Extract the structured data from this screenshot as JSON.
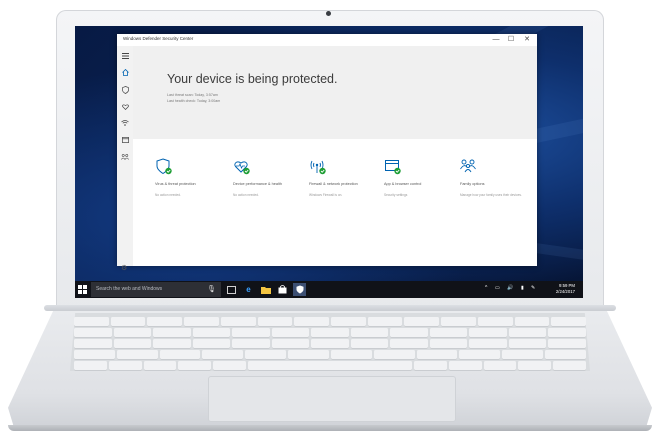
{
  "app": {
    "window_title": "Windows Defender Security Center",
    "controls": {
      "minimize": "—",
      "maximize": "☐",
      "close": "✕"
    },
    "nav_icons": [
      "menu-icon",
      "home-icon",
      "shield-icon",
      "heart-icon",
      "wifi-icon",
      "browser-icon",
      "family-icon",
      "settings-icon"
    ],
    "hero": {
      "title": "Your device is being protected.",
      "line1": "Last threat scan: Today, 3:57am",
      "line2": "Last health check: Today, 3:00am"
    },
    "tiles": [
      {
        "title": "Virus & threat protection",
        "sub": "No action needed.",
        "icon": "virus-shield-icon"
      },
      {
        "title": "Device performance & health",
        "sub": "No action needed.",
        "icon": "health-heart-icon"
      },
      {
        "title": "Firewall & network protection",
        "sub": "Windows Firewall is on.",
        "icon": "firewall-antenna-icon"
      },
      {
        "title": "App & browser control",
        "sub": "Security settings",
        "icon": "app-browser-icon"
      },
      {
        "title": "Family options",
        "sub": "Manage how your family uses their devices.",
        "icon": "family-people-icon"
      }
    ]
  },
  "taskbar": {
    "search_placeholder": "Search the web and Windows",
    "time": "9:59 PM",
    "date": "2/24/2017",
    "app_icons": [
      "task-view-icon",
      "edge-icon",
      "file-explorer-icon",
      "store-icon",
      "defender-icon"
    ]
  },
  "colors": {
    "accent": "#0063b1",
    "ok_green": "#1e9e35",
    "taskbar": "#101218",
    "desktop": "#0b2559"
  }
}
